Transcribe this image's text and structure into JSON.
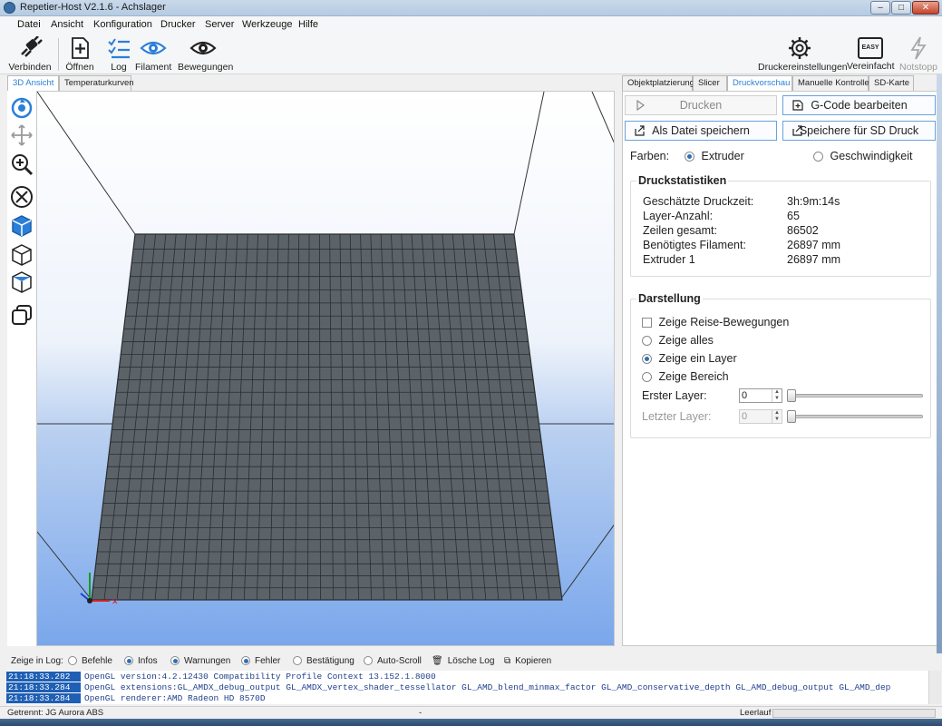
{
  "window": {
    "title": "Repetier-Host V2.1.6 - Achslager",
    "min": "–",
    "max": "□",
    "close": "✕"
  },
  "menu": [
    "Datei",
    "Ansicht",
    "Konfiguration",
    "Drucker",
    "Server",
    "Werkzeuge",
    "Hilfe"
  ],
  "toolbar": {
    "connect": "Verbinden",
    "open": "Öffnen",
    "log": "Log",
    "filament": "Filament",
    "moves": "Bewegungen",
    "printer_settings": "Druckereinstellungen",
    "easy": "Vereinfacht",
    "easy_badge": "EASY",
    "estop": "Notstopp"
  },
  "left_tabs": [
    "3D Ansicht",
    "Temperaturkurven"
  ],
  "right_tabs": [
    "Objektplatzierung",
    "Slicer",
    "Druckvorschau",
    "Manuelle Kontrolle",
    "SD-Karte"
  ],
  "preview": {
    "btn_print": "Drucken",
    "btn_gcode": "G-Code bearbeiten",
    "btn_save_file": "Als Datei speichern",
    "btn_save_sd": "Speichere für SD Druck",
    "colors_label": "Farben:",
    "color_extruder": "Extruder",
    "color_speed": "Geschwindigkeit",
    "stats_title": "Druckstatistiken",
    "stats": [
      {
        "label": "Geschätzte Druckzeit:",
        "value": "3h:9m:14s"
      },
      {
        "label": "Layer-Anzahl:",
        "value": "65"
      },
      {
        "label": "Zeilen gesamt:",
        "value": "86502"
      },
      {
        "label": "Benötigtes Filament:",
        "value": "26897 mm"
      },
      {
        "label": "Extruder 1",
        "value": "26897 mm"
      }
    ],
    "display_title": "Darstellung",
    "show_travel": "Zeige Reise-Bewegungen",
    "show_all": "Zeige alles",
    "show_one_layer": "Zeige ein Layer",
    "show_range": "Zeige Bereich",
    "first_layer_label": "Erster Layer:",
    "first_layer_value": "0",
    "last_layer_label": "Letzter Layer:",
    "last_layer_value": "0"
  },
  "logbar": {
    "label": "Zeige in Log:",
    "commands": "Befehle",
    "infos": "Infos",
    "warnings": "Warnungen",
    "errors": "Fehler",
    "ack": "Bestätigung",
    "autoscroll": "Auto-Scroll",
    "clear": "Lösche Log",
    "copy": "Kopieren"
  },
  "log": [
    {
      "time": "21:18:33.282",
      "msg": "OpenGL version:4.2.12430 Compatibility Profile Context 13.152.1.8000"
    },
    {
      "time": "21:18:33.284",
      "msg": "OpenGL extensions:GL_AMDX_debug_output GL_AMDX_vertex_shader_tessellator GL_AMD_blend_minmax_factor GL_AMD_conservative_depth GL_AMD_debug_output GL_AMD_dep"
    },
    {
      "time": "21:18:33.284",
      "msg": "OpenGL renderer:AMD Radeon HD 8570D"
    }
  ],
  "status": {
    "left": "Getrennt: JG Aurora ABS",
    "mid": "-",
    "right": "Leerlauf"
  },
  "colors": {
    "accent": "#2b7fd9",
    "grid": "#5c6368",
    "gridline": "#2a2d30",
    "sky_top": "#ffffff",
    "sky_bottom": "#7aa7ec"
  }
}
